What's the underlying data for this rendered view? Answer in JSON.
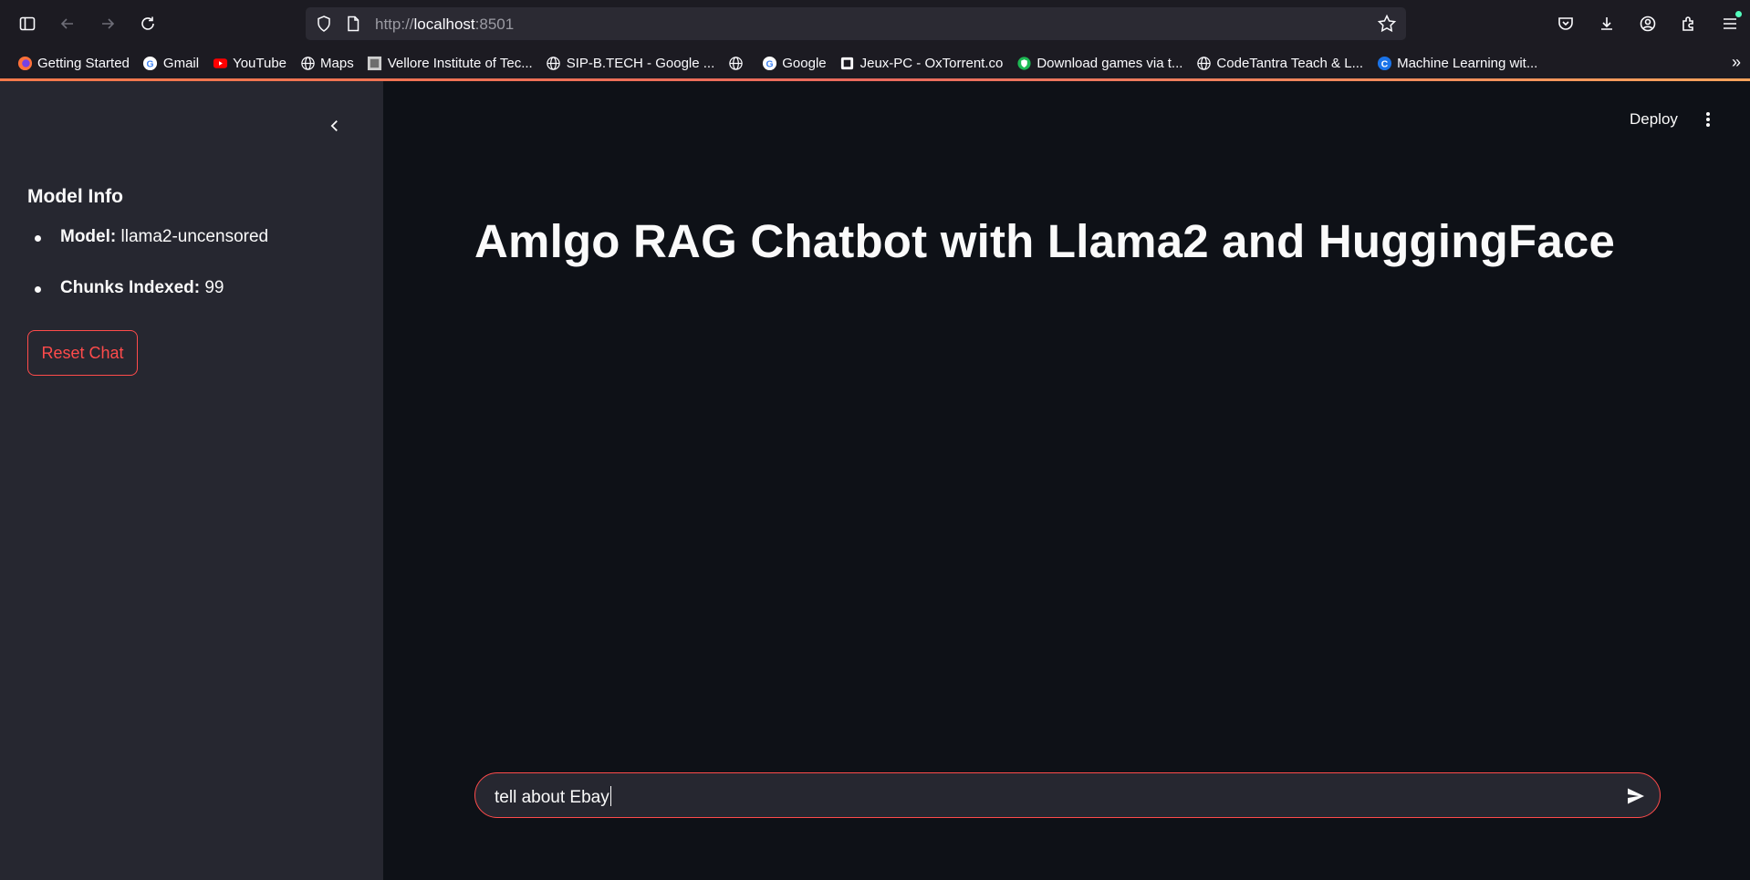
{
  "browser": {
    "url_scheme": "http://",
    "url_host": "localhost",
    "url_port": ":8501",
    "bookmarks": [
      {
        "label": "Getting Started",
        "icon": "firefox-icon"
      },
      {
        "label": "Gmail",
        "icon": "google-icon"
      },
      {
        "label": "YouTube",
        "icon": "youtube-icon"
      },
      {
        "label": "Maps",
        "icon": "globe-icon"
      },
      {
        "label": "Vellore Institute of Tec...",
        "icon": "vit-icon"
      },
      {
        "label": "SIP-B.TECH - Google ...",
        "icon": "globe-icon"
      },
      {
        "label": "",
        "icon": "globe-icon"
      },
      {
        "label": "Google",
        "icon": "google-icon"
      },
      {
        "label": "Jeux-PC - OxTorrent.co",
        "icon": "square-icon"
      },
      {
        "label": "Download games via t...",
        "icon": "shield-green-icon"
      },
      {
        "label": "CodeTantra Teach & L...",
        "icon": "globe-icon"
      },
      {
        "label": "Machine Learning wit...",
        "icon": "c-icon"
      }
    ]
  },
  "sidebar": {
    "heading": "Model Info",
    "items": [
      {
        "key": "Model:",
        "value": "llama2-uncensored"
      },
      {
        "key": "Chunks Indexed:",
        "value": "99"
      }
    ],
    "reset_label": "Reset Chat"
  },
  "header": {
    "deploy_label": "Deploy"
  },
  "main": {
    "title": "Amlgo RAG Chatbot with Llama2 and HuggingFace"
  },
  "chat": {
    "input_value": "tell about Ebay"
  },
  "colors": {
    "accent": "#ff4b4b",
    "sidebar_bg": "#262730",
    "main_bg": "#0e1117"
  }
}
